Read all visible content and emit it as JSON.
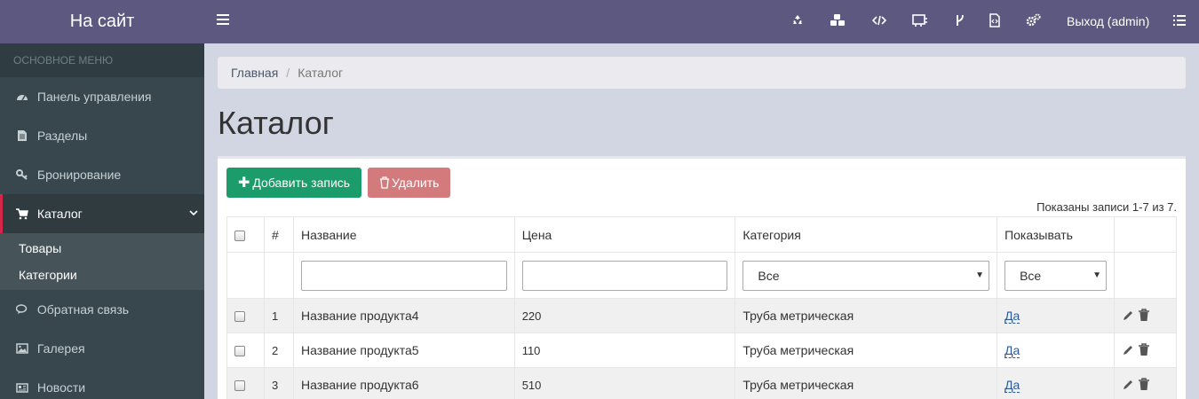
{
  "header": {
    "brand": "На сайт",
    "logout": "Выход (admin)",
    "icons": [
      "recycle-icon",
      "cubes-icon",
      "code-icon",
      "sitemap-icon",
      "fork-icon",
      "file-code-icon",
      "cogs-icon",
      "list-icon"
    ]
  },
  "sidebar": {
    "section": "ОСНОВНОЕ МЕНЮ",
    "items": [
      {
        "label": "Панель управления",
        "icon": "dashboard-icon"
      },
      {
        "label": "Разделы",
        "icon": "file-icon"
      },
      {
        "label": "Бронирование",
        "icon": "key-icon"
      },
      {
        "label": "Каталог",
        "icon": "cart-icon"
      },
      {
        "label": "Обратная связь",
        "icon": "comments-icon"
      },
      {
        "label": "Галерея",
        "icon": "image-icon"
      },
      {
        "label": "Новости",
        "icon": "newspaper-icon"
      }
    ],
    "submenu": [
      "Товары",
      "Категории"
    ]
  },
  "breadcrumb": {
    "home": "Главная",
    "current": "Каталог"
  },
  "page_title": "Каталог",
  "toolbar": {
    "add_label": "Добавить запись",
    "delete_label": "Удалить"
  },
  "records_info": "Показаны записи 1-7 из 7.",
  "table": {
    "columns": [
      "#",
      "Название",
      "Цена",
      "Категория",
      "Показывать"
    ],
    "filters": {
      "category": "Все",
      "show": "Все"
    },
    "rows": [
      {
        "num": "1",
        "name": "Название продукта4",
        "price": "220",
        "category": "Труба метрическая",
        "show": "Да"
      },
      {
        "num": "2",
        "name": "Название продукта5",
        "price": "110",
        "category": "Труба метрическая",
        "show": "Да"
      },
      {
        "num": "3",
        "name": "Название продукта6",
        "price": "510",
        "category": "Труба метрическая",
        "show": "Да"
      }
    ]
  },
  "colors": {
    "topbar": "#5d587f",
    "sidebar": "#37474d",
    "add_button": "#1c9c6b",
    "delete_button": "#d27a7c",
    "active_marker": "#d6244b"
  }
}
